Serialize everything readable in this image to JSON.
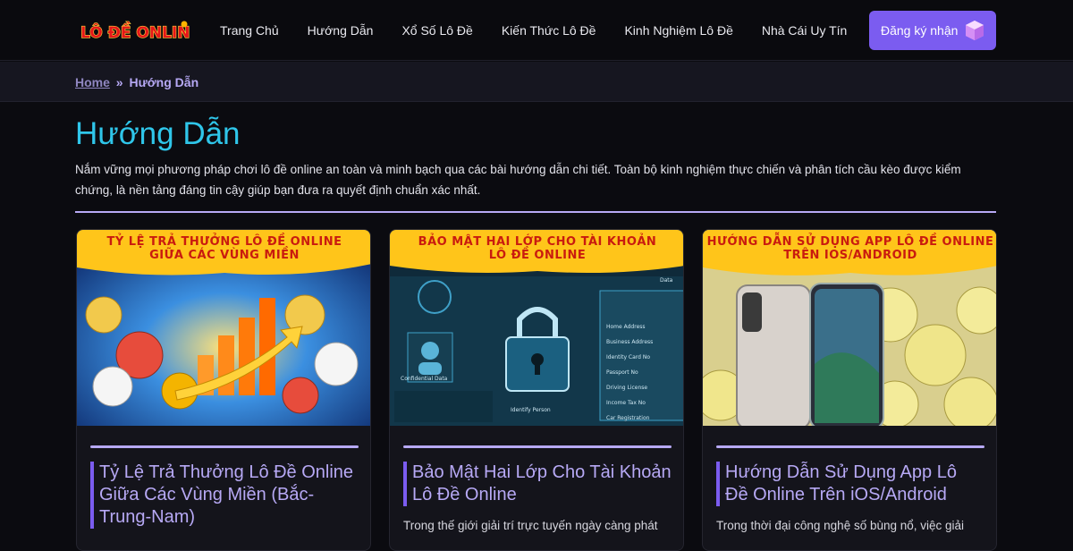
{
  "header": {
    "logo_text": "LÔ ĐỀ ONLINE",
    "nav": [
      "Trang Chủ",
      "Hướng Dẫn",
      "Xổ Số Lô Đề",
      "Kiến Thức Lô Đề",
      "Kinh Nghiệm Lô Đề",
      "Nhà Cái Uy Tín"
    ],
    "cta_label": "Đăng ký nhận",
    "cta_icon": "gem-icon"
  },
  "breadcrumb": {
    "home": "Home",
    "separator": "»",
    "current": "Hướng Dẫn"
  },
  "main": {
    "title": "Hướng Dẫn",
    "intro": "Nắm vững mọi phương pháp chơi lô đề online an toàn và minh bạch qua các bài hướng dẫn chi tiết. Toàn bộ kinh nghiệm thực chiến và phân tích cầu kèo được kiểm chứng, là nền tảng đáng tin cậy giúp bạn đưa ra quyết định chuẩn xác nhất."
  },
  "cards": [
    {
      "image_heading_1": "TỶ LỆ TRẢ THƯỞNG LÔ ĐỀ ONLINE",
      "image_heading_2": "GIỮA CÁC VÙNG MIỀN",
      "title": "Tỷ Lệ Trả Thưởng Lô Đề Online Giữa Các Vùng Miền (Bắc-Trung-Nam)",
      "excerpt": ""
    },
    {
      "image_heading_1": "BẢO MẬT HAI LỚP CHO TÀI KHOẢN",
      "image_heading_2": "LÔ ĐỀ ONLINE",
      "image_labels": [
        "Confidential Data",
        "Identify Person",
        "Home Address",
        "Business Address",
        "Identity Card No",
        "Passport No",
        "Driving License",
        "Income Tax No",
        "Car Registration",
        "Data"
      ],
      "title": "Bảo Mật Hai Lớp Cho Tài Khoản Lô Đề Online",
      "excerpt": "Trong thế giới giải trí trực tuyến ngày càng phát"
    },
    {
      "image_heading_1": "HƯỚNG DẪN SỬ DỤNG APP LÔ ĐỀ ONLINE",
      "image_heading_2": "TRÊN IOS/ANDROID",
      "title": "Hướng Dẫn Sử Dụng App Lô Đề Online Trên iOS/Android",
      "excerpt": "Trong thời đại công nghệ số bùng nổ, việc giải"
    }
  ],
  "colors": {
    "accent": "#7b5cf0",
    "accent_light": "#b7a9f5",
    "title_cyan": "#2fc6ea",
    "banner_yellow": "#ffc51a",
    "banner_red": "#c91b0f"
  }
}
